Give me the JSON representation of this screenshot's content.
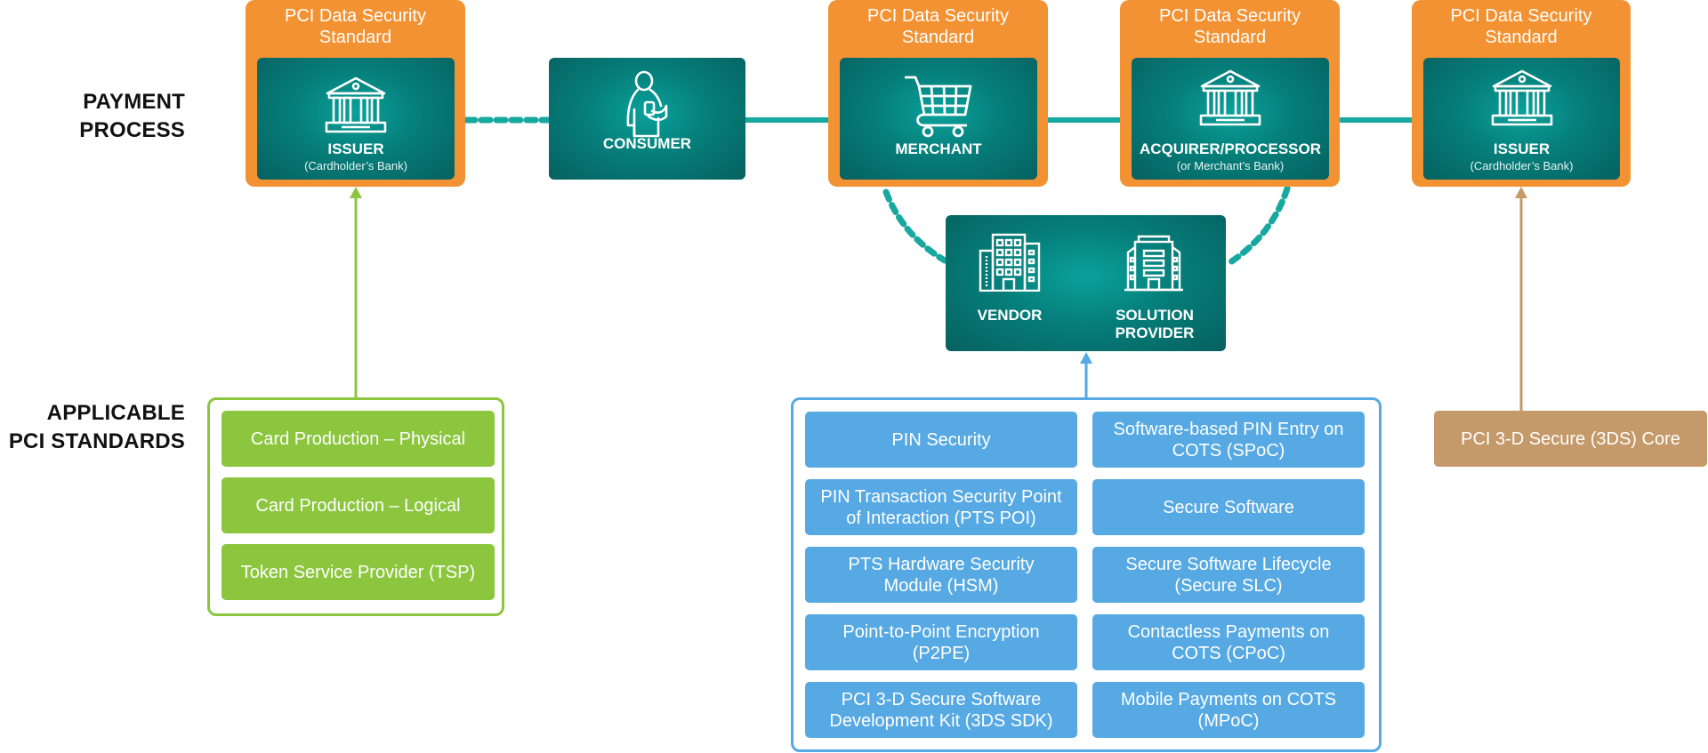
{
  "row_labels": {
    "payment_process": [
      "PAYMENT",
      "PROCESS"
    ],
    "applicable_standards": [
      "APPLICABLE",
      "PCI STANDARDS"
    ]
  },
  "dss_header": [
    "PCI Data Security",
    "Standard"
  ],
  "nodes": {
    "issuer_left": {
      "title": "ISSUER",
      "subtitle": "(Cardholder’s Bank)",
      "icon": "bank-icon"
    },
    "consumer": {
      "title": "CONSUMER",
      "icon": "person-phone-icon"
    },
    "merchant": {
      "title": "MERCHANT",
      "icon": "shopping-cart-icon"
    },
    "acquirer": {
      "title": "ACQUIRER/PROCESSOR",
      "subtitle": "(or Merchant’s Bank)",
      "icon": "bank-icon"
    },
    "issuer_right": {
      "title": "ISSUER",
      "subtitle": "(Cardholder’s Bank)",
      "icon": "bank-icon"
    },
    "vendor": {
      "title": "VENDOR",
      "icon": "office-building-icon"
    },
    "solution_provider": {
      "title": [
        "SOLUTION",
        "PROVIDER"
      ],
      "icon": "hotel-building-icon"
    }
  },
  "standards": {
    "green": [
      "Card Production – Physical",
      "Card Production – Logical",
      "Token Service Provider (TSP)"
    ],
    "blue": [
      [
        "PIN Security",
        ""
      ],
      [
        "Software-based PIN Entry on",
        "COTS (SPoC)"
      ],
      [
        "PIN Transaction Security Point",
        "of Interaction (PTS POI)"
      ],
      [
        "Secure Software",
        ""
      ],
      [
        "PTS Hardware Security",
        "Module (HSM)"
      ],
      [
        "Secure Software Lifecycle",
        "(Secure SLC)"
      ],
      [
        "Point-to-Point Encryption",
        "(P2PE)"
      ],
      [
        "Contactless Payments on",
        "COTS (CPoC)"
      ],
      [
        "PCI 3-D Secure Software",
        "Development Kit (3DS SDK)"
      ],
      [
        "Mobile Payments on COTS",
        "(MPoC)"
      ]
    ],
    "tan": "PCI 3-D Secure (3DS) Core"
  },
  "colors": {
    "orange": "#f39232",
    "teal": "#067e7a",
    "connector": "#17a8a0",
    "green": "#8cc63f",
    "blue": "#56a9e2",
    "tan": "#c59a6a"
  }
}
